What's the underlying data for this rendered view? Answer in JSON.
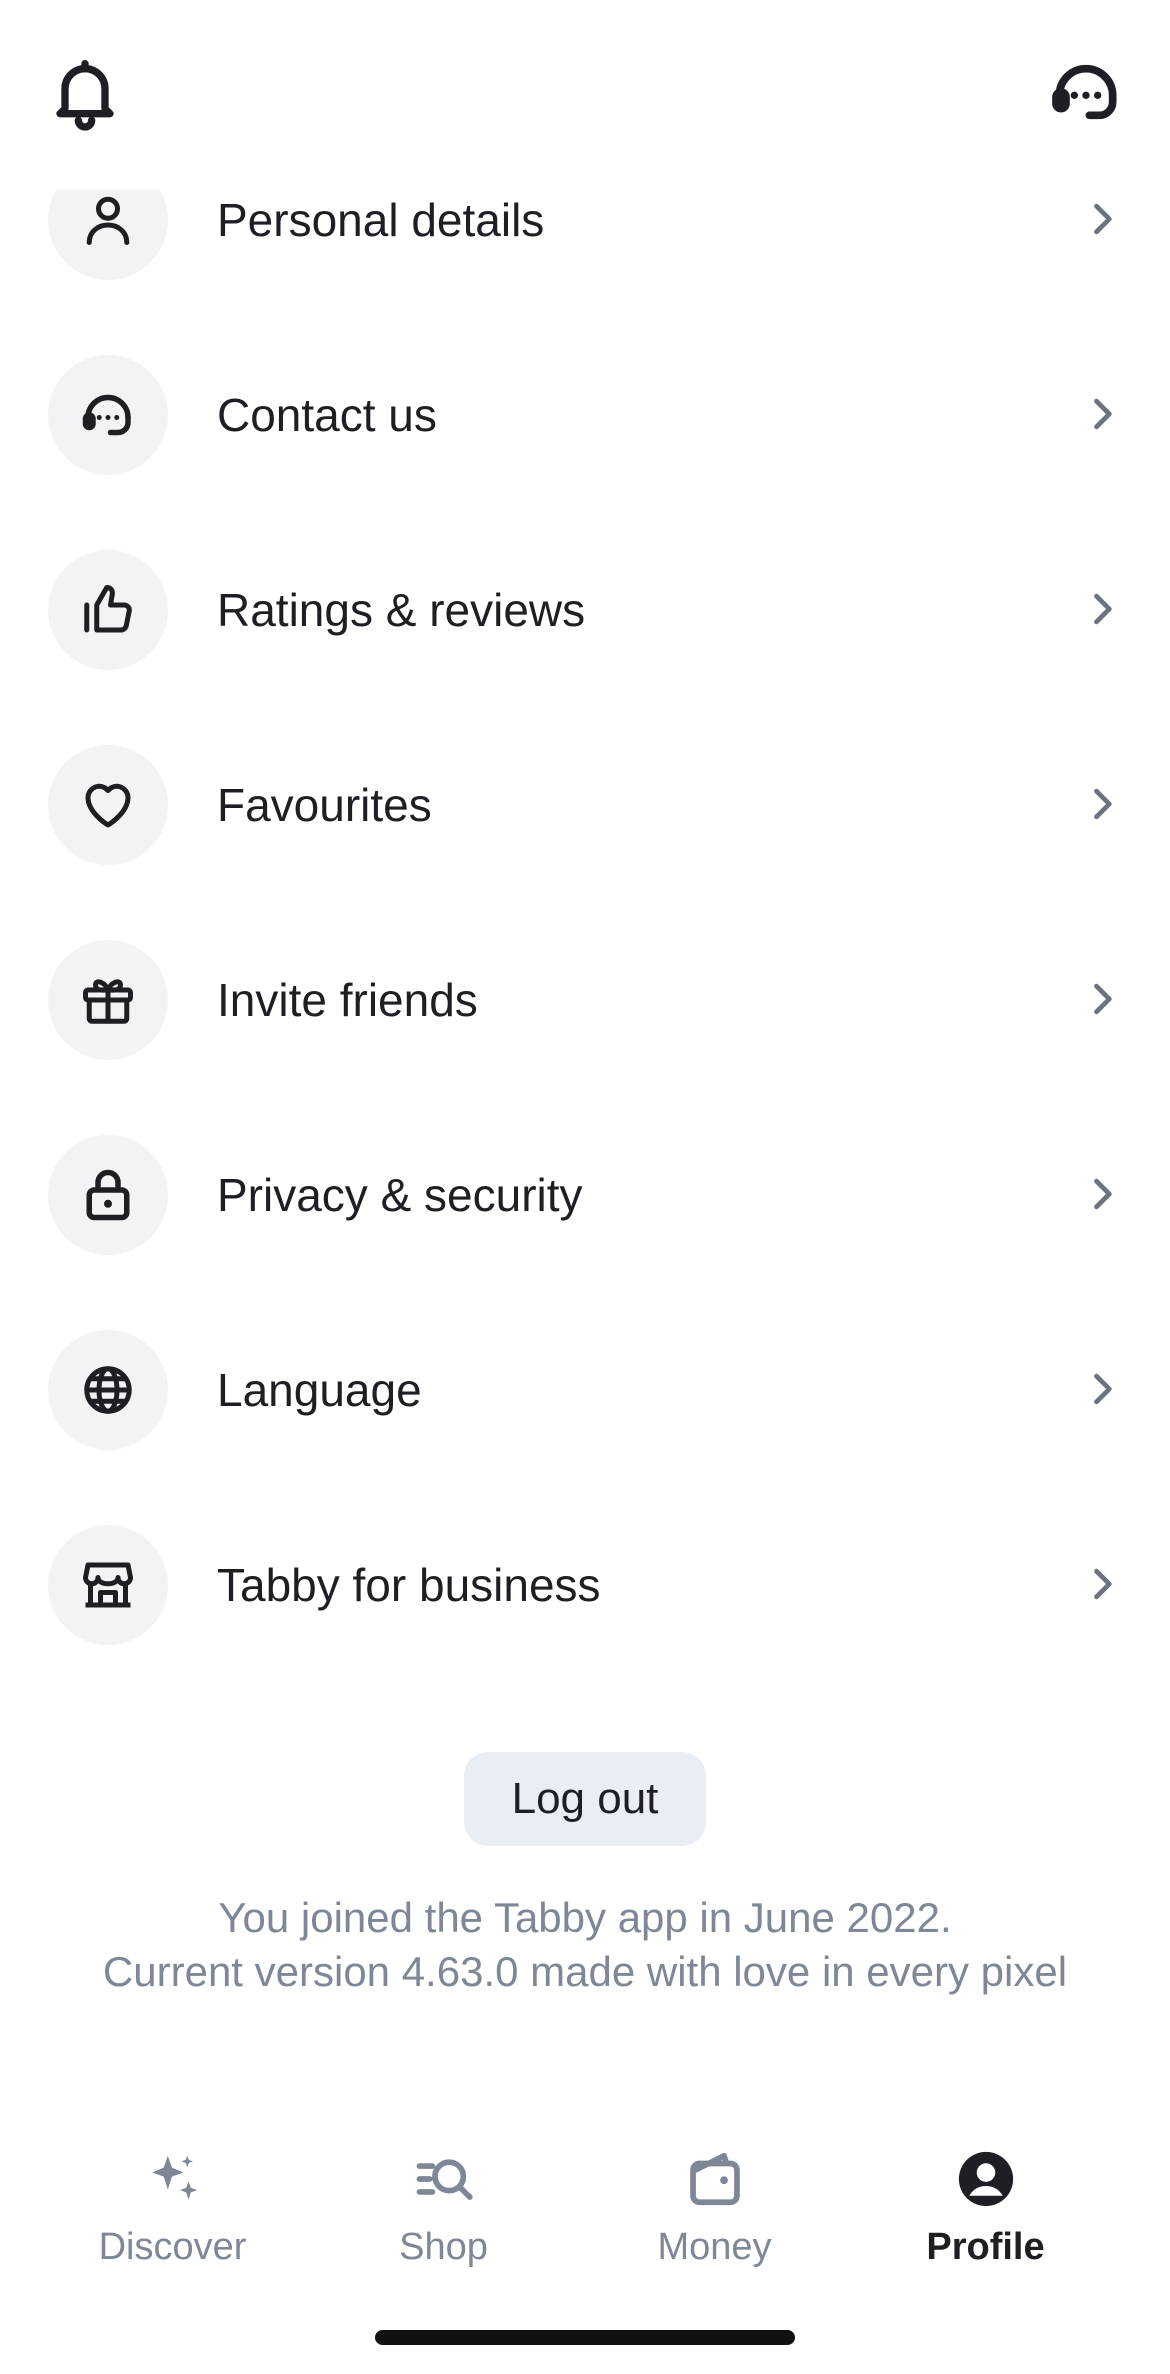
{
  "header": {
    "left_icon": "bell-icon",
    "right_icon": "headset-icon"
  },
  "menu": {
    "items": [
      {
        "label": "Personal details",
        "icon": "person-icon"
      },
      {
        "label": "Contact us",
        "icon": "headset-chat-icon"
      },
      {
        "label": "Ratings & reviews",
        "icon": "thumbs-up-icon"
      },
      {
        "label": "Favourites",
        "icon": "heart-icon"
      },
      {
        "label": "Invite friends",
        "icon": "gift-icon"
      },
      {
        "label": "Privacy & security",
        "icon": "lock-icon"
      },
      {
        "label": "Language",
        "icon": "globe-icon"
      },
      {
        "label": "Tabby for business",
        "icon": "store-icon"
      }
    ]
  },
  "logout": {
    "label": "Log out"
  },
  "footer": {
    "joined": "You joined the Tabby app in June 2022.",
    "version": "Current version 4.63.0 made with love in every pixel"
  },
  "tabs": [
    {
      "label": "Discover",
      "icon": "sparkles-icon",
      "active": false
    },
    {
      "label": "Shop",
      "icon": "search-list-icon",
      "active": false
    },
    {
      "label": "Money",
      "icon": "wallet-icon",
      "active": false
    },
    {
      "label": "Profile",
      "icon": "profile-icon",
      "active": true
    }
  ],
  "colors": {
    "text": "#1d1f24",
    "muted": "#7e8796",
    "icon_circle": "#f2f3f5",
    "logout_bg": "#e9edf4"
  }
}
